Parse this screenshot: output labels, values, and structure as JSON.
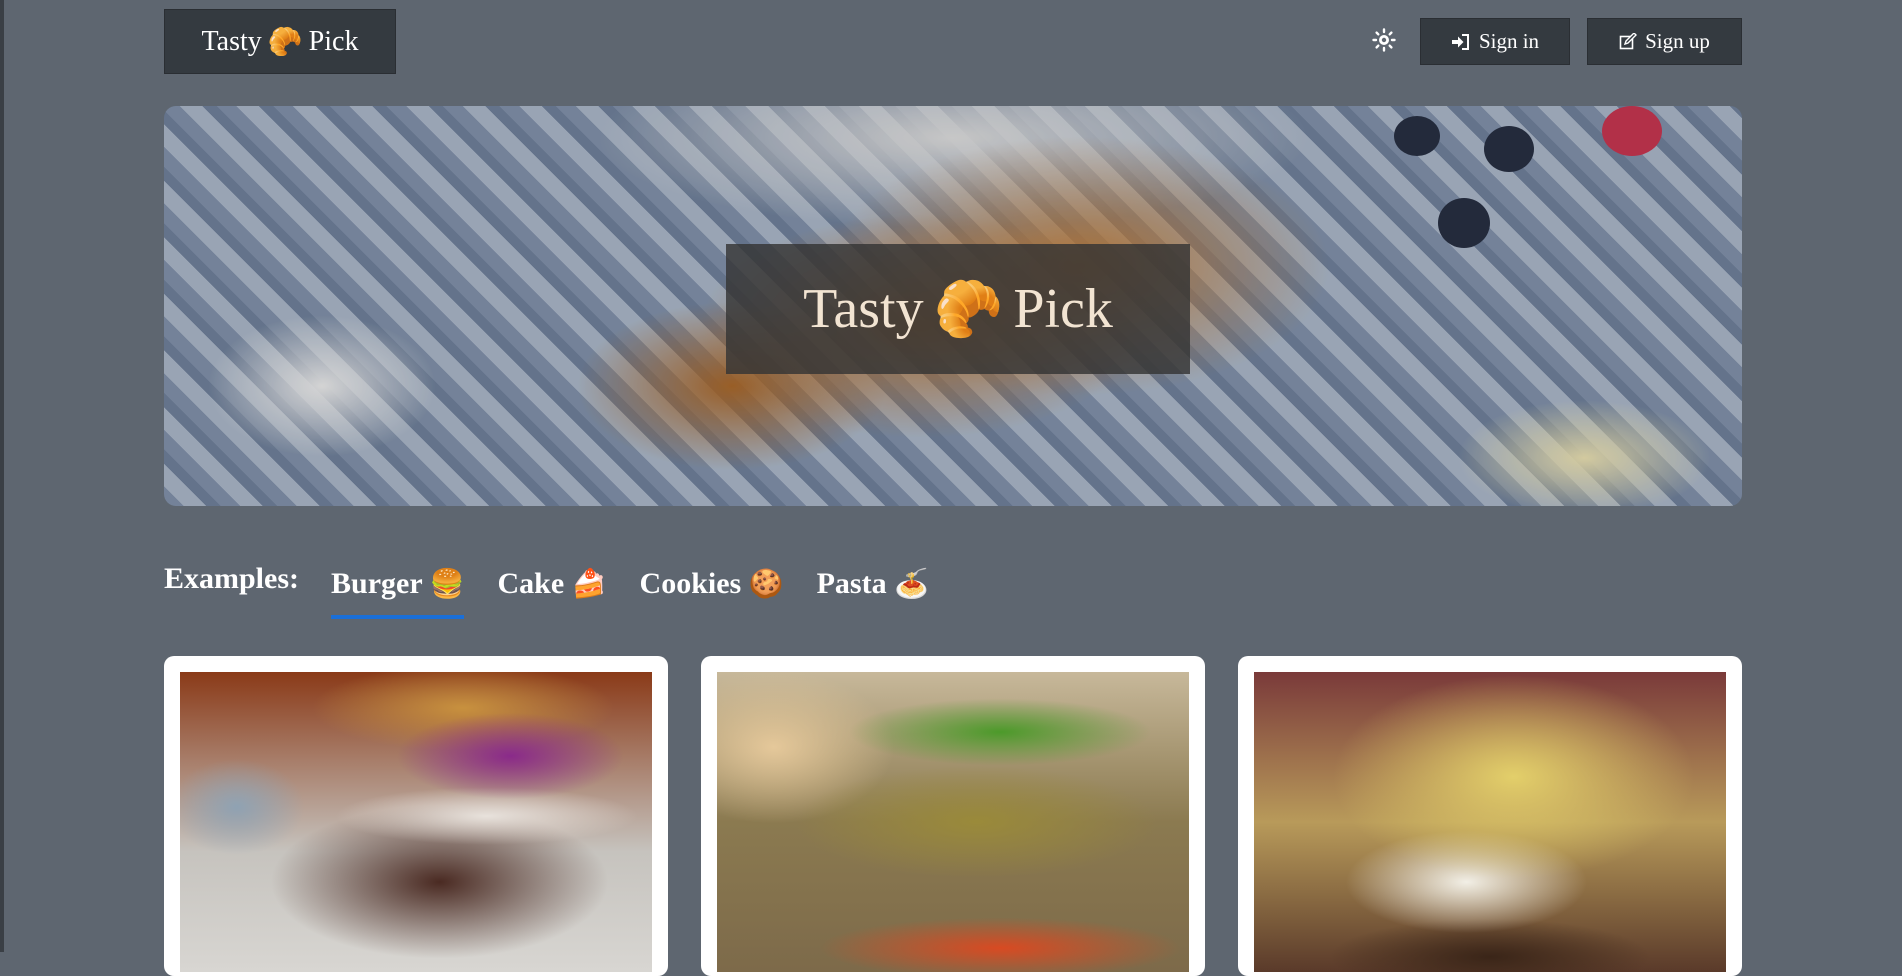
{
  "brand": {
    "text_left": "Tasty",
    "emoji": "🥐",
    "text_right": "Pick"
  },
  "header": {
    "theme_icon": "sun-icon",
    "signin_label": "Sign in",
    "signin_icon": "sign-in-icon",
    "signup_label": "Sign up",
    "signup_icon": "edit-icon"
  },
  "hero": {
    "image": "croissants-on-plate",
    "title_left": "Tasty",
    "title_emoji": "🥐",
    "title_right": "Pick"
  },
  "examples": {
    "label": "Examples:",
    "tabs": [
      {
        "label": "Burger",
        "emoji": "🍔",
        "active": true
      },
      {
        "label": "Cake",
        "emoji": "🍰",
        "active": false
      },
      {
        "label": "Cookies",
        "emoji": "🍪",
        "active": false
      },
      {
        "label": "Pasta",
        "emoji": "🍝",
        "active": false
      }
    ]
  },
  "cards": [
    {
      "image": "burger-with-red-cabbage"
    },
    {
      "image": "veggie-burger"
    },
    {
      "image": "burger-with-hollandaise"
    }
  ],
  "colors": {
    "accent": "#1a6fd8",
    "navbar": "#343a40",
    "background": "#5e6670"
  }
}
